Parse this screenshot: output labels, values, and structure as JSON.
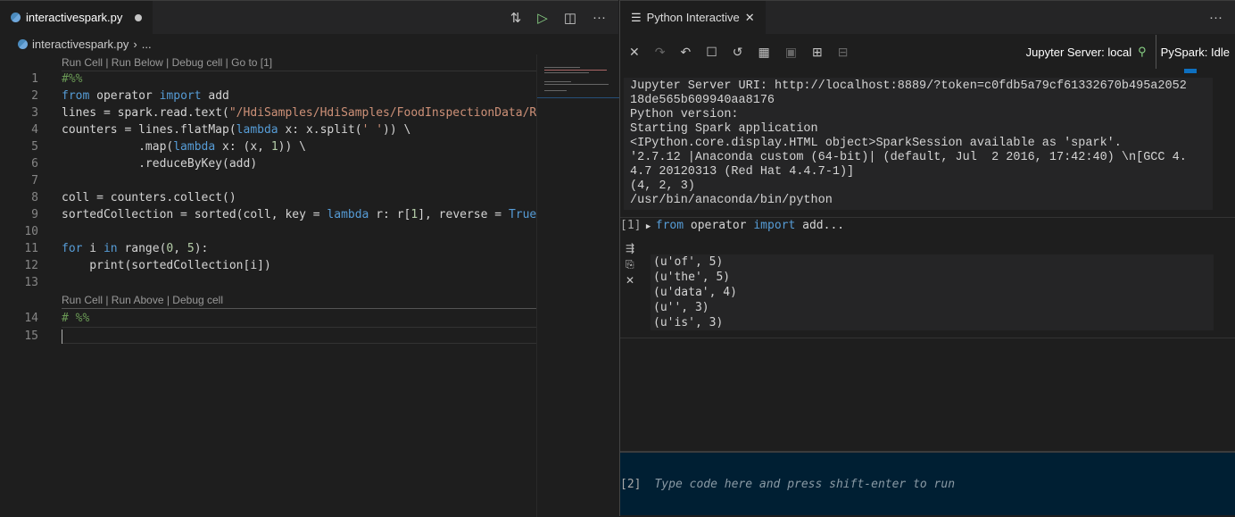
{
  "editor": {
    "tab_title": "interactivespark.py",
    "breadcrumb": [
      "interactivespark.py",
      "..."
    ],
    "codelens_1": "Run Cell | Run Below | Debug cell | Go to [1]",
    "codelens_2": "Run Cell | Run Above | Debug cell",
    "lines": [
      [
        [
          "cm",
          "#%%"
        ]
      ],
      [
        [
          "kw",
          "from"
        ],
        [
          "id",
          " operator "
        ],
        [
          "kw",
          "import"
        ],
        [
          "id",
          " add"
        ]
      ],
      [
        [
          "id",
          "lines = spark.read.text("
        ],
        [
          "str",
          "\"/HdiSamples/HdiSamples/FoodInspectionData/REA"
        ]
      ],
      [
        [
          "id",
          "counters = lines.flatMap("
        ],
        [
          "kw",
          "lambda"
        ],
        [
          "id",
          " x: x.split("
        ],
        [
          "str",
          "' '"
        ],
        [
          "id",
          ")) \\"
        ]
      ],
      [
        [
          "id",
          "           .map("
        ],
        [
          "kw",
          "lambda"
        ],
        [
          "id",
          " x: (x, "
        ],
        [
          "num",
          "1"
        ],
        [
          "id",
          ")) \\"
        ]
      ],
      [
        [
          "id",
          "           .reduceByKey(add)"
        ]
      ],
      [],
      [
        [
          "id",
          "coll = counters.collect()"
        ]
      ],
      [
        [
          "id",
          "sortedCollection = sorted(coll, key = "
        ],
        [
          "kw",
          "lambda"
        ],
        [
          "id",
          " r: r["
        ],
        [
          "num",
          "1"
        ],
        [
          "id",
          "], reverse = "
        ],
        [
          "kw",
          "True"
        ],
        [
          "id",
          ")"
        ]
      ],
      [],
      [
        [
          "kw",
          "for"
        ],
        [
          "id",
          " i "
        ],
        [
          "kw",
          "in"
        ],
        [
          "id",
          " range("
        ],
        [
          "num",
          "0"
        ],
        [
          "id",
          ", "
        ],
        [
          "num",
          "5"
        ],
        [
          "id",
          "):"
        ]
      ],
      [
        [
          "id",
          "    print(sortedCollection[i])"
        ]
      ],
      [],
      [
        [
          "cm",
          "# %%"
        ]
      ],
      []
    ]
  },
  "interactive": {
    "tab_title": "Python Interactive",
    "server_status": "Jupyter Server: local",
    "kernel_status": "PySpark: Idle",
    "connected_color": "#89d185",
    "startup_output": "Jupyter Server URI: http://localhost:8889/?token=c0fdb5a79cf61332670b495a2052\n18de565b609940aa8176\nPython version:\nStarting Spark application\n<IPython.core.display.HTML object>SparkSession available as 'spark'.\n'2.7.12 |Anaconda custom (64-bit)| (default, Jul  2 2016, 17:42:40) \\n[GCC 4.\n4.7 20120313 (Red Hat 4.4.7-1)]\n(4, 2, 3)\n/usr/bin/anaconda/bin/python",
    "cell_number": "[1]",
    "cell_code_kw1": "from",
    "cell_code_mid": " operator ",
    "cell_code_kw2": "import",
    "cell_code_end": " add...",
    "cell_output": "(u'of', 5)\n(u'the', 5)\n(u'data', 4)\n(u'', 3)\n(u'is', 3)",
    "input_number": "[2]",
    "input_placeholder": "Type code here and press shift-enter to run"
  }
}
